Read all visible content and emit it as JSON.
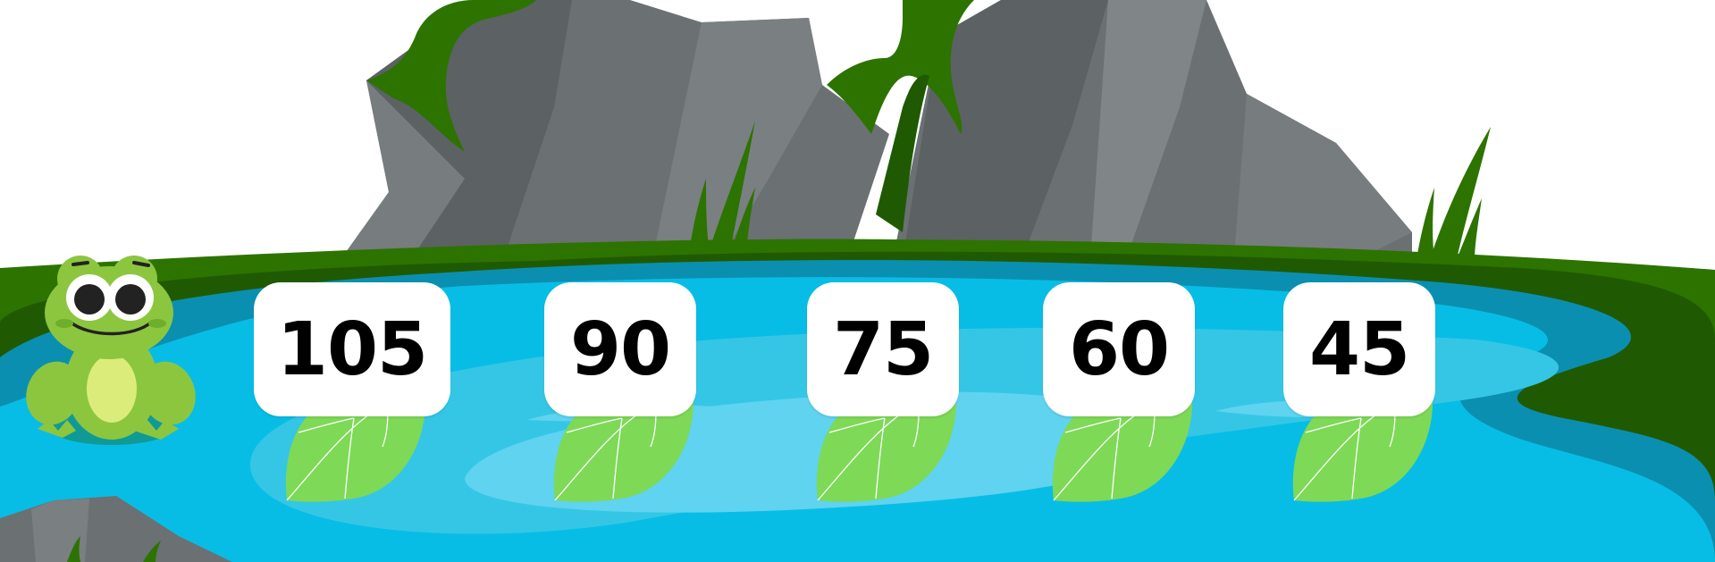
{
  "game": {
    "lily_pads": [
      {
        "number": "105"
      },
      {
        "number": "90"
      },
      {
        "number": "75"
      },
      {
        "number": "60"
      },
      {
        "number": "45"
      }
    ]
  },
  "colors": {
    "water_light": "#5fd3ef",
    "water_mid": "#35c6e6",
    "water_dark": "#0b8fb0",
    "grass": "#2d7300",
    "grass_dark": "#1f5a02",
    "rock_light": "#767b7e",
    "rock_dark": "#5a5f62",
    "leaf": "#7ed957",
    "frog": "#8cc63f"
  }
}
